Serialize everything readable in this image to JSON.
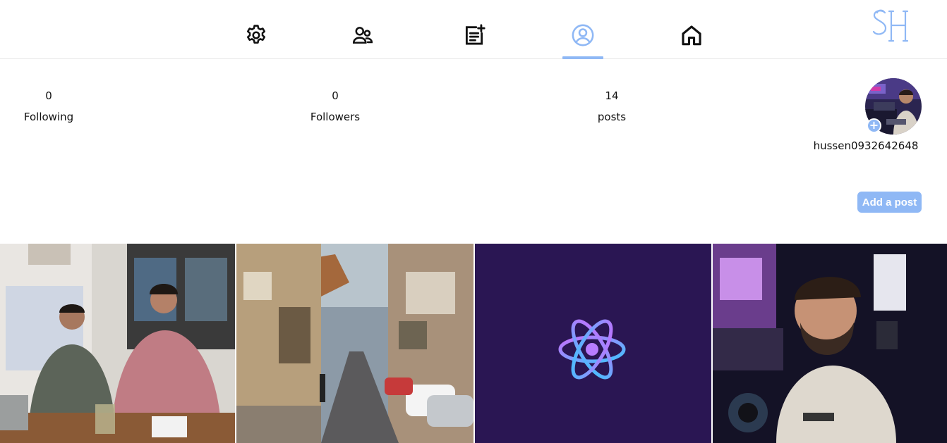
{
  "nav": {
    "items": [
      {
        "name": "settings",
        "icon": "gear-icon",
        "active": false
      },
      {
        "name": "friends",
        "icon": "users-icon",
        "active": false
      },
      {
        "name": "new-post",
        "icon": "add-note-icon",
        "active": false
      },
      {
        "name": "profile",
        "icon": "user-circle-icon",
        "active": true
      },
      {
        "name": "home",
        "icon": "home-icon",
        "active": false
      }
    ],
    "logo_icon": "sh-monogram-logo"
  },
  "profile": {
    "stats": [
      {
        "value": "0",
        "label": "Following"
      },
      {
        "value": "0",
        "label": "Followers"
      },
      {
        "value": "14",
        "label": "posts"
      }
    ],
    "username": "hussen0932642648",
    "add_photo_symbol": "+",
    "add_post_label": "Add a post"
  },
  "posts": [
    {
      "description": "two men seated at a cafe table"
    },
    {
      "description": "narrow street with parked cars and balconies"
    },
    {
      "description": "react logo on purple background"
    },
    {
      "description": "man selfie on a street at night"
    }
  ],
  "colors": {
    "accent": "#8fb8f5",
    "react_bg": "#2a1653",
    "border": "#e6e6e6"
  }
}
